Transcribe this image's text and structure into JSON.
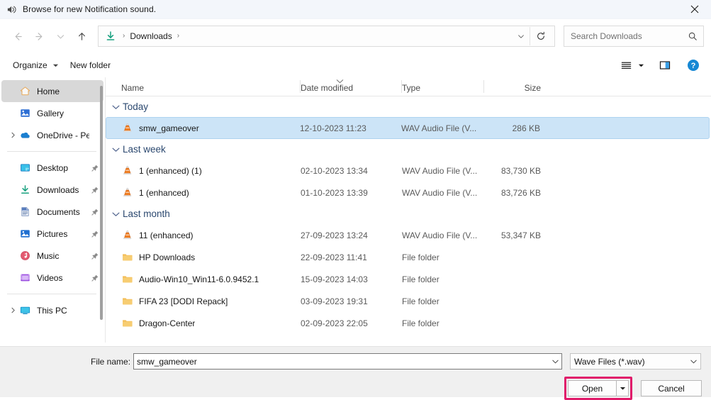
{
  "titlebar": {
    "icon": "speaker-icon",
    "title": "Browse for new Notification sound.",
    "close_label": "✕"
  },
  "navbar": {
    "back_label": "←",
    "forward_label": "→",
    "recent_label": "⌄",
    "up_label": "↑",
    "address": {
      "icon": "downloads-arrow-icon",
      "crumbs": [
        "Downloads"
      ],
      "separator": "›",
      "dropdown": "⌄"
    },
    "refresh_label": "⟳",
    "search": {
      "placeholder": "Search Downloads",
      "value": "",
      "icon": "search-icon"
    }
  },
  "commandbar": {
    "organize_label": "Organize",
    "organize_caret": "▾",
    "new_folder_label": "New folder",
    "view_icon": "list-view-icon",
    "view_caret": "▾",
    "preview_pane_icon": "preview-pane-icon",
    "help_icon": "help-icon",
    "help_glyph": "?"
  },
  "sidebar": {
    "items": [
      {
        "label": "Home",
        "icon": "home-icon",
        "expander": false,
        "pinned": false,
        "selected": true
      },
      {
        "label": "Gallery",
        "icon": "gallery-icon",
        "expander": false,
        "pinned": false,
        "selected": false
      },
      {
        "label": "OneDrive - Pers…",
        "icon": "onedrive-icon",
        "expander": true,
        "pinned": false,
        "selected": false
      },
      {
        "separator": true
      },
      {
        "label": "Desktop",
        "icon": "desktop-icon",
        "expander": false,
        "pinned": true,
        "selected": false
      },
      {
        "label": "Downloads",
        "icon": "downloads-icon",
        "expander": false,
        "pinned": true,
        "selected": false
      },
      {
        "label": "Documents",
        "icon": "documents-icon",
        "expander": false,
        "pinned": true,
        "selected": false
      },
      {
        "label": "Pictures",
        "icon": "pictures-icon",
        "expander": false,
        "pinned": true,
        "selected": false
      },
      {
        "label": "Music",
        "icon": "music-icon",
        "expander": false,
        "pinned": true,
        "selected": false
      },
      {
        "label": "Videos",
        "icon": "videos-icon",
        "expander": false,
        "pinned": true,
        "selected": false
      },
      {
        "separator": true
      },
      {
        "label": "This PC",
        "icon": "this-pc-icon",
        "expander": true,
        "pinned": false,
        "selected": false
      }
    ],
    "expander_glyph": "›",
    "pin_glyph": "📌"
  },
  "filelist": {
    "columns": [
      {
        "label": "Name",
        "key": "name",
        "sorted": false
      },
      {
        "label": "Date modified",
        "key": "date",
        "sorted": true,
        "direction": "desc"
      },
      {
        "label": "Type",
        "key": "type",
        "sorted": false
      },
      {
        "label": "Size",
        "key": "size",
        "sorted": false
      }
    ],
    "sort_glyph": "⌄",
    "group_chevron": "⌄",
    "groups": [
      {
        "label": "Today",
        "rows": [
          {
            "name": "smw_gameover",
            "date": "12-10-2023 11:23",
            "type": "WAV Audio File (V...",
            "size": "286 KB",
            "icon": "vlc-media-icon",
            "selected": true
          }
        ]
      },
      {
        "label": "Last week",
        "rows": [
          {
            "name": "1 (enhanced) (1)",
            "date": "02-10-2023 13:34",
            "type": "WAV Audio File (V...",
            "size": "83,730 KB",
            "icon": "vlc-media-icon",
            "selected": false
          },
          {
            "name": "1 (enhanced)",
            "date": "01-10-2023 13:39",
            "type": "WAV Audio File (V...",
            "size": "83,726 KB",
            "icon": "vlc-media-icon",
            "selected": false
          }
        ]
      },
      {
        "label": "Last month",
        "rows": [
          {
            "name": "11 (enhanced)",
            "date": "27-09-2023 13:24",
            "type": "WAV Audio File (V...",
            "size": "53,347 KB",
            "icon": "vlc-media-icon",
            "selected": false
          },
          {
            "name": "HP Downloads",
            "date": "22-09-2023 11:41",
            "type": "File folder",
            "size": "",
            "icon": "folder-icon",
            "selected": false
          },
          {
            "name": "Audio-Win10_Win11-6.0.9452.1",
            "date": "15-09-2023 14:03",
            "type": "File folder",
            "size": "",
            "icon": "folder-icon",
            "selected": false
          },
          {
            "name": "FIFA 23 [DODI Repack]",
            "date": "03-09-2023 19:31",
            "type": "File folder",
            "size": "",
            "icon": "folder-icon",
            "selected": false
          },
          {
            "name": "Dragon-Center",
            "date": "02-09-2023 22:05",
            "type": "File folder",
            "size": "",
            "icon": "folder-icon",
            "selected": false
          }
        ]
      }
    ]
  },
  "footer": {
    "filename_label": "File name:",
    "filename_value": "smw_gameover",
    "filename_dropdown": "⌄",
    "filetype_value": "Wave Files (*.wav)",
    "filetype_dropdown": "⌄",
    "open_label": "Open",
    "open_split_glyph": "▾",
    "cancel_label": "Cancel",
    "highlight_color": "#e01b6a"
  }
}
